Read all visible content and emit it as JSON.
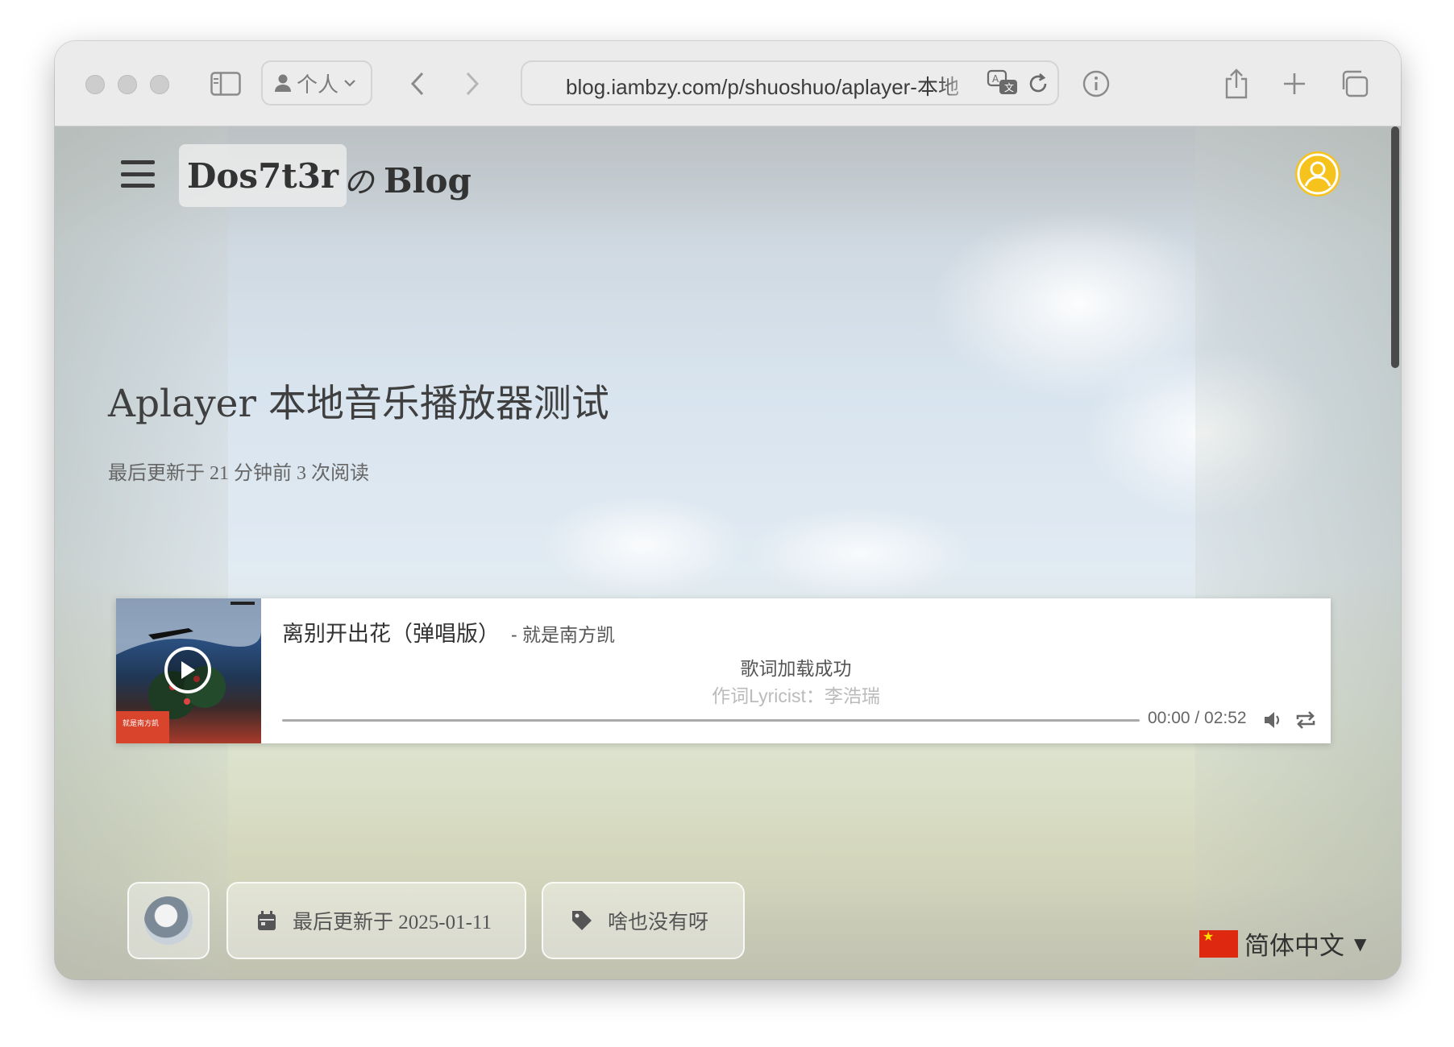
{
  "browser": {
    "profile_label": "个人",
    "url": "blog.iambzy.com/p/shuoshuo/aplayer-本地"
  },
  "site": {
    "brand": "Dos7t3r",
    "brand_no": "の",
    "brand_blog": "Blog"
  },
  "post": {
    "title": "Aplayer 本地音乐播放器测试",
    "meta": "最后更新于 21 分钟前 3 次阅读"
  },
  "player": {
    "title": "离别开出花（弹唱版）",
    "artist": "- 就是南方凯",
    "lyric_current": "歌词加载成功",
    "lyric_next": "作词Lyricist：李浩瑞",
    "time": "00:00 / 02:52",
    "progress": 0,
    "cover_text": "就是南方凯"
  },
  "footer": {
    "updated": "最后更新于 2025-01-11",
    "tags": "啥也没有呀",
    "language": "简体中文",
    "caret": "▼"
  }
}
